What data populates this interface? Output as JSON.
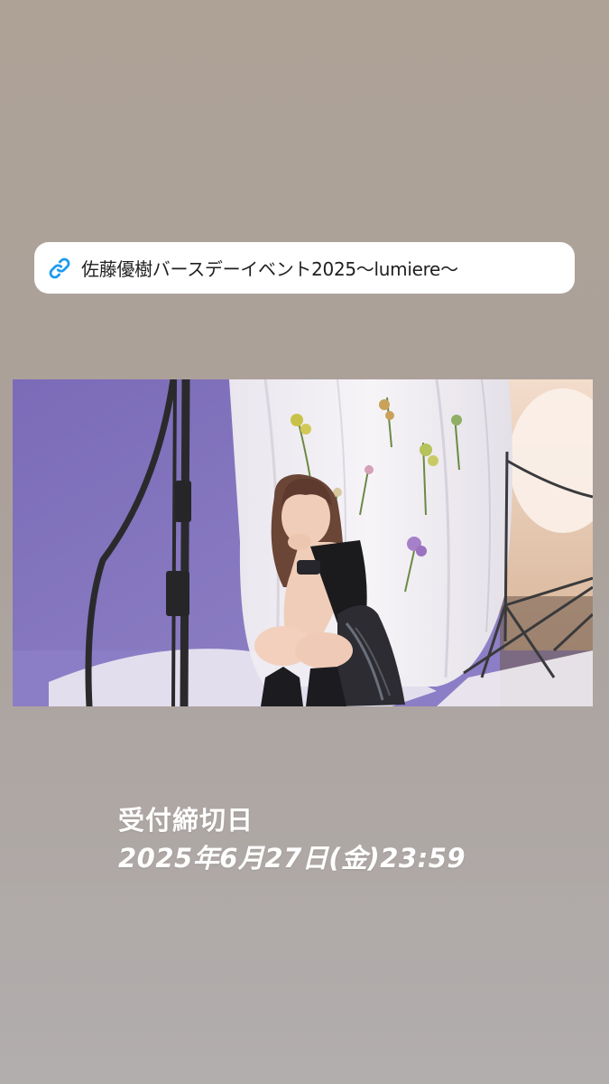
{
  "link_sticker": {
    "icon": "link-icon",
    "text": "佐藤優樹バースデーイベント2025〜lumiere〜",
    "icon_color": "#1d9bf0"
  },
  "photo": {
    "background_left_color": "#8a7bc0",
    "background_right_color": "#f1eef2"
  },
  "deadline": {
    "label": "受付締切日",
    "date": "2025年6月27日(金)23:59"
  }
}
